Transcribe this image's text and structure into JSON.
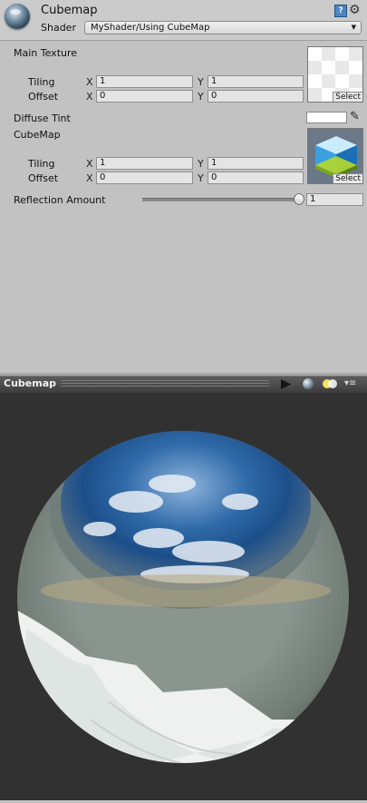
{
  "header": {
    "title": "Cubemap",
    "shader_label": "Shader",
    "shader_value": "MyShader/Using CubeMap",
    "help_glyph": "?",
    "gear_glyph": "⚙",
    "dropdown_glyph": "▼"
  },
  "properties": {
    "main_texture": {
      "label": "Main Texture",
      "tiling_label": "Tiling",
      "offset_label": "Offset",
      "x_label": "X",
      "y_label": "Y",
      "tiling_x": "1",
      "tiling_y": "1",
      "offset_x": "0",
      "offset_y": "0",
      "select_label": "Select"
    },
    "diffuse_tint": {
      "label": "Diffuse Tint",
      "color": "#ffffff",
      "picker_glyph": "✎"
    },
    "cubemap": {
      "label": "CubeMap",
      "tiling_label": "Tiling",
      "offset_label": "Offset",
      "x_label": "X",
      "y_label": "Y",
      "tiling_x": "1",
      "tiling_y": "1",
      "offset_x": "0",
      "offset_y": "0",
      "select_label": "Select"
    },
    "reflection": {
      "label": "Reflection Amount",
      "value": "1",
      "slider_fraction": 1.0
    }
  },
  "preview": {
    "title": "Cubemap",
    "menu_glyph": "▾≡"
  },
  "colors": {
    "inspector_bg": "#c2c2c2",
    "preview_bg": "#313131",
    "toolbar": "#4a4a4a"
  }
}
